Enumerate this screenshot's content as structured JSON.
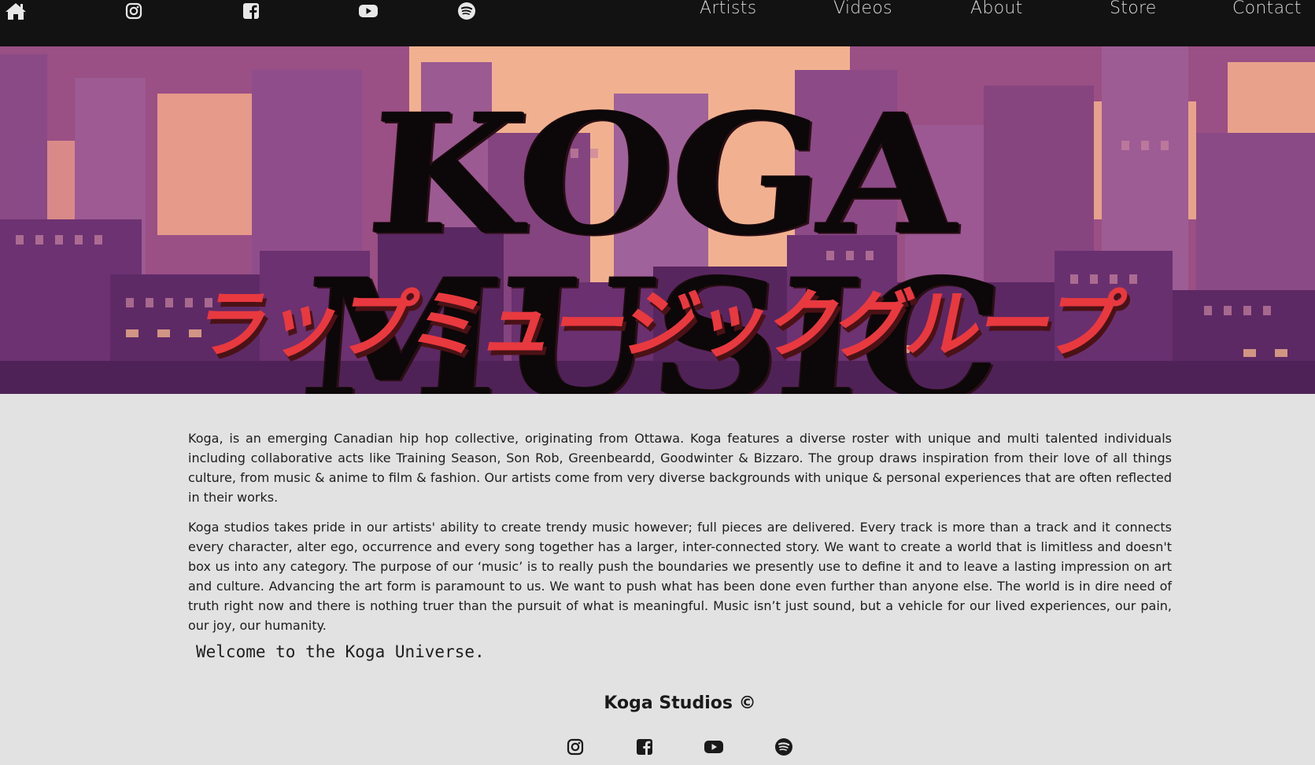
{
  "nav": {
    "icons": [
      "home-icon",
      "instagram-icon",
      "facebook-icon",
      "youtube-icon",
      "spotify-icon"
    ],
    "links": [
      "Artists",
      "Videos",
      "About",
      "Store",
      "Contact"
    ]
  },
  "hero": {
    "title": "KOGA MUSIC",
    "subtitle": "ラップミュージックグループ"
  },
  "content": {
    "paragraph_1": "Koga, is an emerging Canadian hip hop collective, originating from Ottawa. Koga features a diverse roster with unique and multi talented individuals including collaborative acts like Training Season, Son Rob, Greenbeardd, Goodwinter & Bizzaro. The group draws inspiration from their love of all things culture, from music & anime to film & fashion. Our artists come from very diverse backgrounds with unique & personal experiences that are often reflected in their works.",
    "paragraph_2": "Koga studios takes pride in our artists' ability to create trendy music however; full pieces are delivered. Every track is more than a track and it connects every character, alter ego, occurrence and every song together has a larger, inter-connected story. We want to create a world that is limitless and doesn't box us into any category. The purpose of our ‘music’ is to really push the boundaries we presently use to define it and to leave a lasting impression on art and culture. Advancing the art form is paramount to us. We want to push what has been done even further than anyone else. The world is in dire need of truth right now and there is nothing truer than the pursuit of what is meaningful. Music isn’t just sound, but a vehicle for our lived experiences, our pain, our joy, our humanity.",
    "welcome": "Welcome to the Koga Universe."
  },
  "footer": {
    "title": "Koga Studios ©",
    "icons": [
      "instagram-icon",
      "facebook-icon",
      "youtube-icon",
      "spotify-icon"
    ]
  },
  "colors": {
    "nav_bg": "#121212",
    "page_bg": "#e2e2e2",
    "hero_accent_red": "#e8393f",
    "hero_purple": "#7b3f7d",
    "hero_peach": "#f2b48f"
  }
}
